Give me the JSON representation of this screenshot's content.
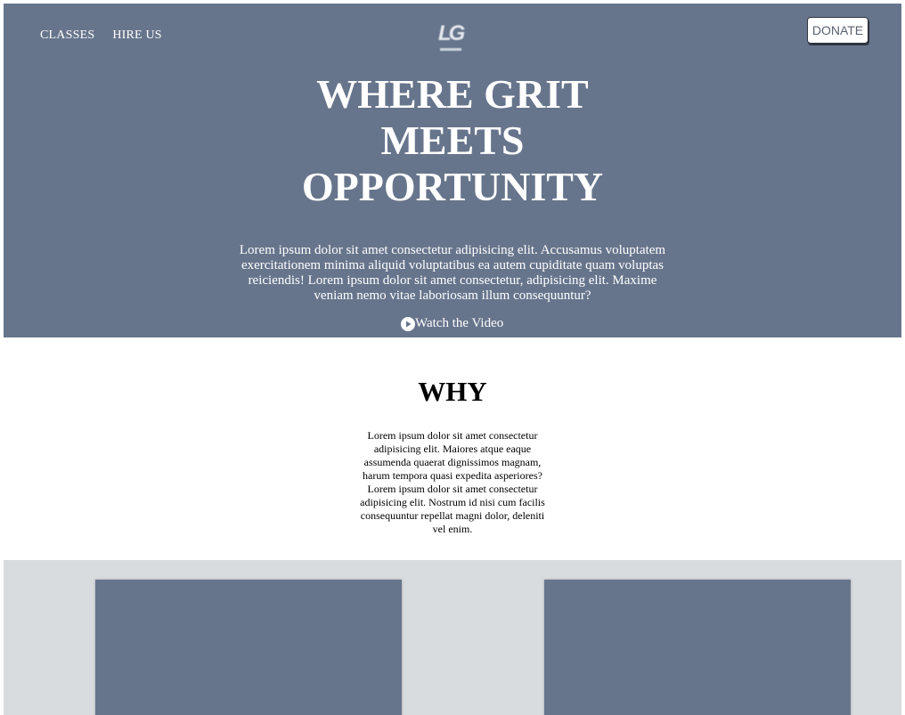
{
  "header": {
    "nav_items": [
      {
        "label": "CLASSES"
      },
      {
        "label": "HIRE US"
      }
    ],
    "logo": {
      "text": "LG",
      "icon": "lg-logo"
    },
    "donate_label": "DONATE"
  },
  "hero": {
    "title_lines": [
      "WHERE GRIT",
      "MEETS",
      "OPPORTUNITY"
    ],
    "description": "Lorem ipsum dolor sit amet consectetur adipisicing elit. Accusamus voluptatem exercitationem minima aliquid voluptatibus ea autem cupiditate quam voluptas reiciendis! Lorem ipsum dolor sit amet consectetur, adipisicing elit. Maxime veniam nemo vitae laboriosam illum consequuntur?",
    "watch_video_label": "Watch the Video",
    "watch_video_icon": "play-circle-icon"
  },
  "why": {
    "title": "WHY",
    "text": "Lorem ipsum dolor sit amet consectetur adipisicing elit. Maiores atque eaque assumenda quaerat dignissimos magnam, harum tempora quasi expedita asperiores? Lorem ipsum dolor sit amet consectetur adipisicing elit. Nostrum id nisi cum facilis consequuntur repellat magni dolor, deleniti vel enim."
  },
  "colors": {
    "hero_bg": "#67758c",
    "cards_section_bg": "#d9dcdf",
    "card_bg": "#67758c",
    "text_light": "#ffffff",
    "text_dark": "#000000"
  }
}
